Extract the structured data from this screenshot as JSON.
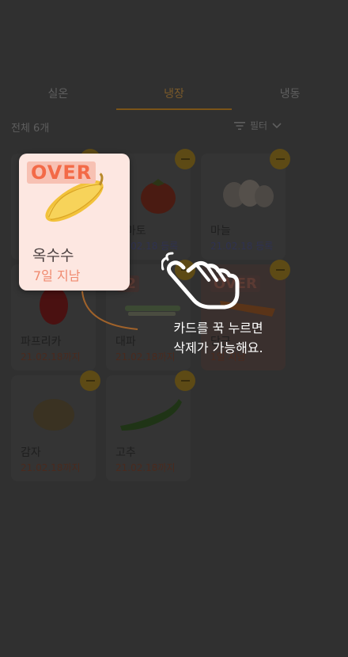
{
  "tabs": [
    {
      "label": "실온"
    },
    {
      "label": "냉장"
    },
    {
      "label": "냉동"
    }
  ],
  "summary": {
    "count_label": "전체 6개"
  },
  "filter": {
    "label": "필터"
  },
  "items": [
    {
      "name": "토마토",
      "date": "21.02.18 등록"
    },
    {
      "name": "마늘",
      "date": "21.02.18 등록"
    },
    {
      "name": "파프리카",
      "date": "21.02.18까지"
    },
    {
      "name": "대파",
      "date": "21.02.18까지",
      "badge": "-2"
    },
    {
      "name": "당근",
      "date": "1일 지남",
      "badge": "OVER"
    },
    {
      "name": "감자",
      "date": "21.02.18까지"
    },
    {
      "name": "고추",
      "date": "21.02.18까지"
    }
  ],
  "highlight": {
    "badge": "OVER",
    "name": "옥수수",
    "status": "7일 지남"
  },
  "hint": {
    "line1": "카드를 꾹 누르면",
    "line2": "삭제가 가능해요."
  },
  "colors": {
    "dim_bg": "#303030",
    "accent": "#7a5418",
    "over_text": "#f36a47",
    "highlight_card": "#fde7e1"
  }
}
